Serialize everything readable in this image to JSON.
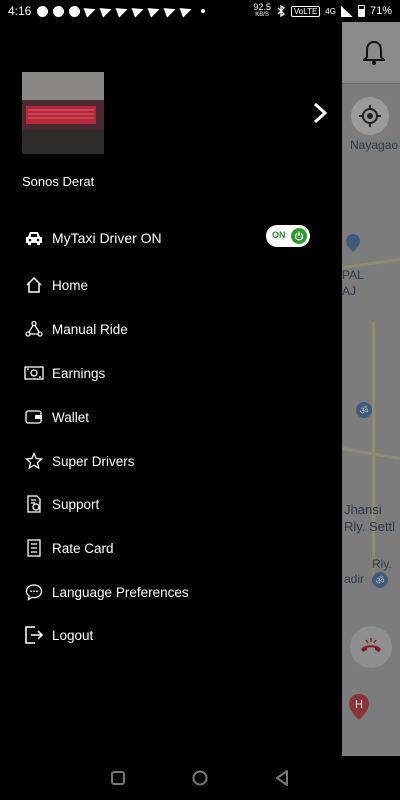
{
  "status_bar": {
    "time": "4:16",
    "net_speed_value": "92.5",
    "net_speed_unit": "KB/S",
    "network_badge": "VoLTE",
    "signal_label": "4G",
    "battery": "71%"
  },
  "profile": {
    "name": "Sonos Derat"
  },
  "driver_toggle": {
    "label": "MyTaxi Driver ON",
    "state": "ON"
  },
  "menu": {
    "items": [
      {
        "label": "Home",
        "icon": "home-icon"
      },
      {
        "label": "Manual Ride",
        "icon": "share-nodes-icon"
      },
      {
        "label": "Earnings",
        "icon": "cash-icon"
      },
      {
        "label": "Wallet",
        "icon": "wallet-icon"
      },
      {
        "label": "Super Drivers",
        "icon": "star-icon"
      },
      {
        "label": "Support",
        "icon": "support-icon"
      },
      {
        "label": "Rate Card",
        "icon": "rate-card-icon"
      },
      {
        "label": "Language Preferences",
        "icon": "chat-bubble-icon"
      },
      {
        "label": "Logout",
        "icon": "logout-icon"
      }
    ]
  },
  "map": {
    "labels": [
      "Nayagao",
      "PAL",
      "AJ",
      "Jhansi",
      "Rly. Settl",
      "Rly.",
      "adir"
    ]
  },
  "colors": {
    "accent_green": "#2e9b2e",
    "background": "#000000",
    "map_gray": "#7c7c7c"
  }
}
